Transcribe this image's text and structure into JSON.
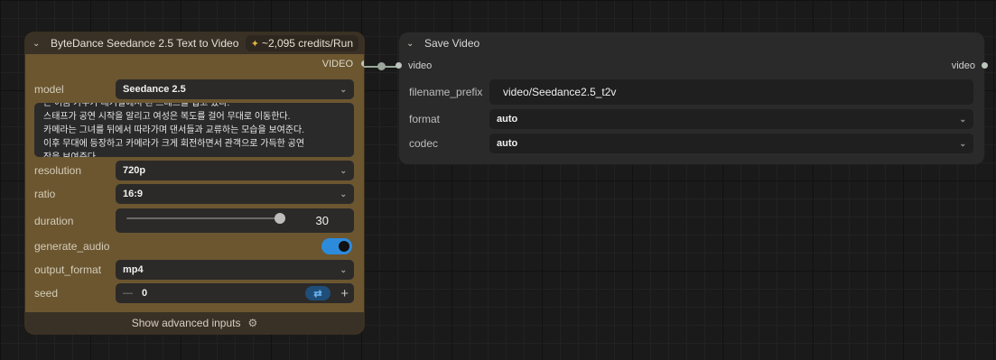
{
  "node1": {
    "title": "ByteDance Seedance 2.5 Text to Video",
    "credits": "~2,095 credits/Run",
    "output_label": "VIDEO",
    "widgets": {
      "model": {
        "label": "model",
        "value": "Seedance 2.5"
      },
      "prompt_lines": [
        "는 어둠 가수가 대기실에서 흰 드레스를 입고 있다.",
        "스태프가 공연 시작을 알리고 여성은 복도를 걸어 무대로 이동한다.",
        "카메라는 그녀를 뒤에서 따라가며 댄서들과 교류하는 모습을 보여준다.",
        "이후 무대에 등장하고 카메라가 크게 회전하면서 관객으로 가득한 공연",
        "장을 보여준다."
      ],
      "resolution": {
        "label": "resolution",
        "value": "720p"
      },
      "ratio": {
        "label": "ratio",
        "value": "16:9"
      },
      "duration": {
        "label": "duration",
        "value": "30",
        "fraction": 1.0
      },
      "generate_audio": {
        "label": "generate_audio",
        "value": true
      },
      "output_format": {
        "label": "output_format",
        "value": "mp4"
      },
      "seed": {
        "label": "seed",
        "value": "0"
      }
    },
    "footer": "Show advanced inputs"
  },
  "node2": {
    "title": "Save Video",
    "input_label": "video",
    "output_label": "video",
    "widgets": {
      "filename_prefix": {
        "label": "filename_prefix",
        "value": "video/Seedance2.5_t2v"
      },
      "format": {
        "label": "format",
        "value": "auto"
      },
      "codec": {
        "label": "codec",
        "value": "auto"
      }
    }
  },
  "colors": {
    "node1_body": "#6b5630",
    "toggle_on": "#2d8bdc",
    "credit_icon": "#e2b43b"
  }
}
